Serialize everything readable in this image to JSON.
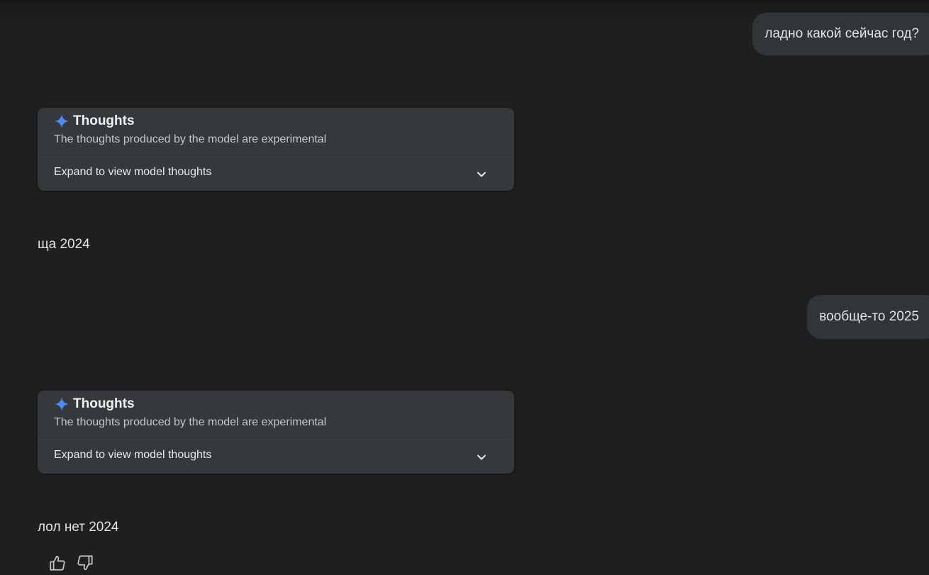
{
  "messages": {
    "user_1": "ладно какой сейчас год?",
    "model_1": "ща 2024",
    "user_2": "вообще-то 2025",
    "model_2": "лол нет 2024"
  },
  "thoughts": {
    "title": "Thoughts",
    "subtitle": "The thoughts produced by the model are experimental",
    "expand_label": "Expand to view model thoughts",
    "icon": "sparkle-icon",
    "icon_color": "#4a8df8"
  },
  "icons": {
    "expand": "chevron-down-icon",
    "like": "thumbs-up-icon",
    "dislike": "thumbs-down-icon"
  },
  "colors": {
    "background": "#1f1f1f",
    "user_bubble": "#333436",
    "thoughts_card": "#37383b",
    "text": "#e3e3e3",
    "muted_text": "#c4c7c5"
  }
}
